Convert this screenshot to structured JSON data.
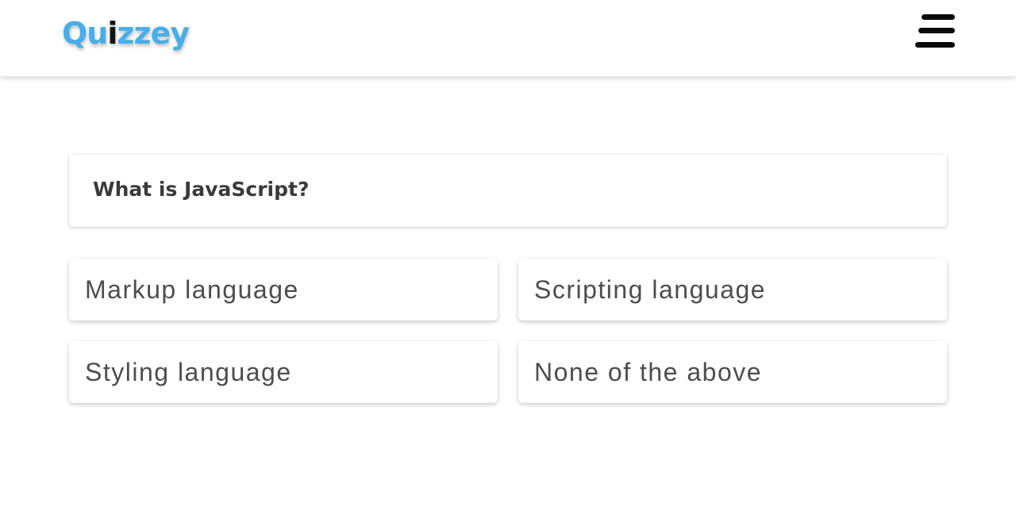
{
  "header": {
    "logo": {
      "part_a": "Qu",
      "part_b": "i",
      "part_c": "zzey"
    },
    "menu_icon": "hamburger-menu-icon"
  },
  "quiz": {
    "question": "What is JavaScript?",
    "options": [
      {
        "label": "Markup language"
      },
      {
        "label": "Scripting language"
      },
      {
        "label": "Styling language"
      },
      {
        "label": "None of the above"
      }
    ]
  },
  "colors": {
    "brand_blue": "#47aeea",
    "brand_dark": "#111111",
    "text": "#4d4d4d"
  }
}
